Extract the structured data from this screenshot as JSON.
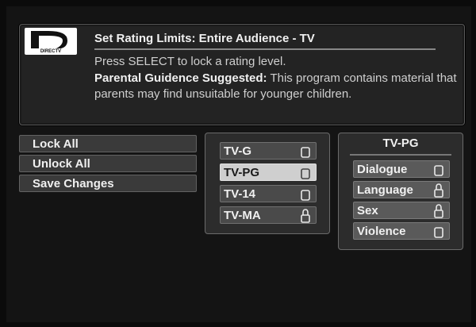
{
  "header": {
    "logo_text": "DIRECTV",
    "title": "Set Rating Limits: Entire Audience - TV",
    "instruction": "Press SELECT to lock a rating level.",
    "guidance_label": "Parental Guidence Suggested:",
    "guidance_text": "This program contains material that parents may find unsuitable for younger children."
  },
  "menu": {
    "items": [
      {
        "label": "Lock All"
      },
      {
        "label": "Unlock All"
      },
      {
        "label": "Save Changes"
      }
    ]
  },
  "ratings": {
    "items": [
      {
        "label": "TV-G",
        "locked": false,
        "selected": false
      },
      {
        "label": "TV-PG",
        "locked": false,
        "selected": true
      },
      {
        "label": "TV-14",
        "locked": false,
        "selected": false
      },
      {
        "label": "TV-MA",
        "locked": true,
        "selected": false
      }
    ]
  },
  "content": {
    "title": "TV-PG",
    "items": [
      {
        "label": "Dialogue",
        "locked": false
      },
      {
        "label": "Language",
        "locked": true
      },
      {
        "label": "Sex",
        "locked": true
      },
      {
        "label": "Violence",
        "locked": false
      }
    ]
  },
  "colors": {
    "background": "#0b0b0b",
    "panel": "#2c2c2c",
    "selected": "#cfcfcf"
  }
}
